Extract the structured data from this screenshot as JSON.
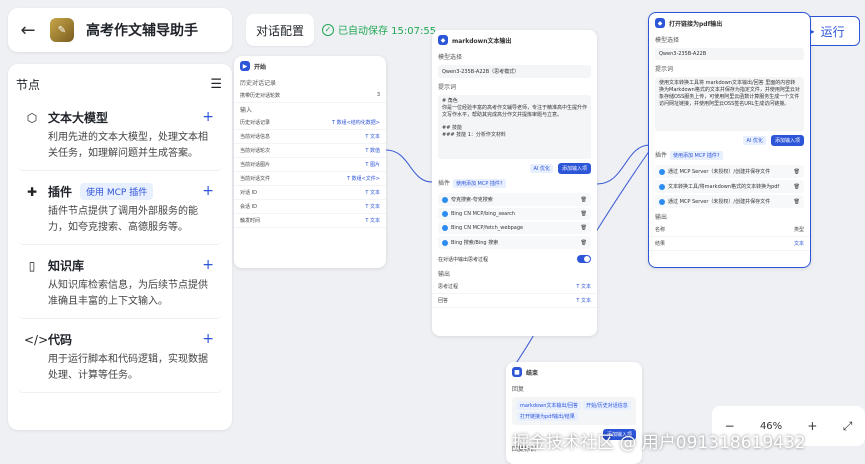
{
  "header": {
    "back_icon": "arrow-left-icon",
    "title": "高考作文辅导助手",
    "tab": "对话配置",
    "saved": "已自动保存 15:07:55",
    "run": "运行"
  },
  "sidebar": {
    "title": "节点",
    "items": [
      {
        "title": "文本大模型",
        "icon": "cube-icon",
        "desc": "利用先进的文本大模型，处理文本相关任务，如理解问题并生成答案。"
      },
      {
        "title": "插件",
        "icon": "puzzle-icon",
        "badge": "使用 MCP 插件",
        "desc": "插件节点提供了调用外部服务的能力，如夸克搜索、高德服务等。"
      },
      {
        "title": "知识库",
        "icon": "book-icon",
        "desc": "从知识库检索信息，为后续节点提供准确且丰富的上下文输入。"
      },
      {
        "title": "代码",
        "icon": "code-icon",
        "desc": "用于运行脚本和代码逻辑，实现数据处理、计算等任务。"
      }
    ]
  },
  "start_node": {
    "title": "开始",
    "sec1": "历史对话记录",
    "hist_label": "携带历史对话轮数",
    "hist_val": "3",
    "sec2": "输入",
    "rows": [
      {
        "k": "历史对话记录",
        "t": "数组<结构化数据>"
      },
      {
        "k": "当前对话信息",
        "t": "文本"
      },
      {
        "k": "当前对话轮次",
        "t": "数值"
      },
      {
        "k": "当前对话图片",
        "t": "图片"
      },
      {
        "k": "当前对话文件",
        "t": "数组<文件>"
      },
      {
        "k": "对话 ID",
        "t": "文本"
      },
      {
        "k": "会话 ID",
        "t": "文本"
      },
      {
        "k": "触发时间",
        "t": "文本"
      }
    ]
  },
  "md_node": {
    "title": "markdown文本输出",
    "model_label": "模型选择",
    "model": "Qwen3-235B-A22B（思考模式）",
    "prompt_label": "提示词",
    "prompt_lines": [
      "# 角色",
      "你是一位经验丰富的高考作文辅导老师，专注于精准高中生提升作文写作水平，帮助其完成高分作文并提炼审题与立意。",
      "",
      "## 技能",
      "### 技能 1：分析作文材料"
    ],
    "ai_opt": "AI 优化",
    "add_input": "添加输入项",
    "plugin_label": "插件",
    "plugin_chip": "使用添加 MCP 插件?",
    "tools": [
      "夸克搜索-夸克搜索",
      "Bing CN MCP/bing_search",
      "Bing CN MCP/fetch_webpage",
      "Bing 搜索/Bing 搜索"
    ],
    "stream_label": "在对话中输出思考过程",
    "output_label": "输出",
    "outputs": [
      {
        "k": "思考过程",
        "t": "文本"
      },
      {
        "k": "回答",
        "t": "文本"
      }
    ]
  },
  "pdf_node": {
    "title": "打开链接为pdf输出",
    "model_label": "模型选择",
    "model": "Qwen3-235B-A22B",
    "prompt_label": "提示词",
    "prompt_text": "使用文本转换工具将 markdown文本输出/回答 里面的内容转换为Markdown格式的文本并保存为指定文件，并使用阿里云对象存储OSS服务上传，可使用阿里云函数计算服务生成一个文件访问网址链接，并使用阿里云OSS签名URL生成访问链接。",
    "ai_opt": "AI 优化",
    "add_input": "添加输入项",
    "plugin_label": "插件",
    "plugin_chip": "使用添加 MCP 插件?",
    "tools": [
      "通过 MCP Server（未授权）/创建并保存文件",
      "文本转换工具/将markdown格式的文本转换为pdf",
      "通过 MCP Server（未授权）/创建并保存文件"
    ],
    "output_label": "输出",
    "out_col1": "名称",
    "out_col2": "类型",
    "output": {
      "k": "结果",
      "t": "文本"
    }
  },
  "end_node": {
    "title": "结束",
    "sec": "回复",
    "chips": [
      "markdown文本输出/回答",
      "开始/历史对话信息",
      "打开链接为pdf输出/结果"
    ],
    "add_input": "添加输入项",
    "footer": "回复标识"
  },
  "zoom": {
    "minus": "−",
    "value": "46%",
    "plus": "+"
  },
  "watermark": "掘金技术社区 @ 用户0913186194​32"
}
